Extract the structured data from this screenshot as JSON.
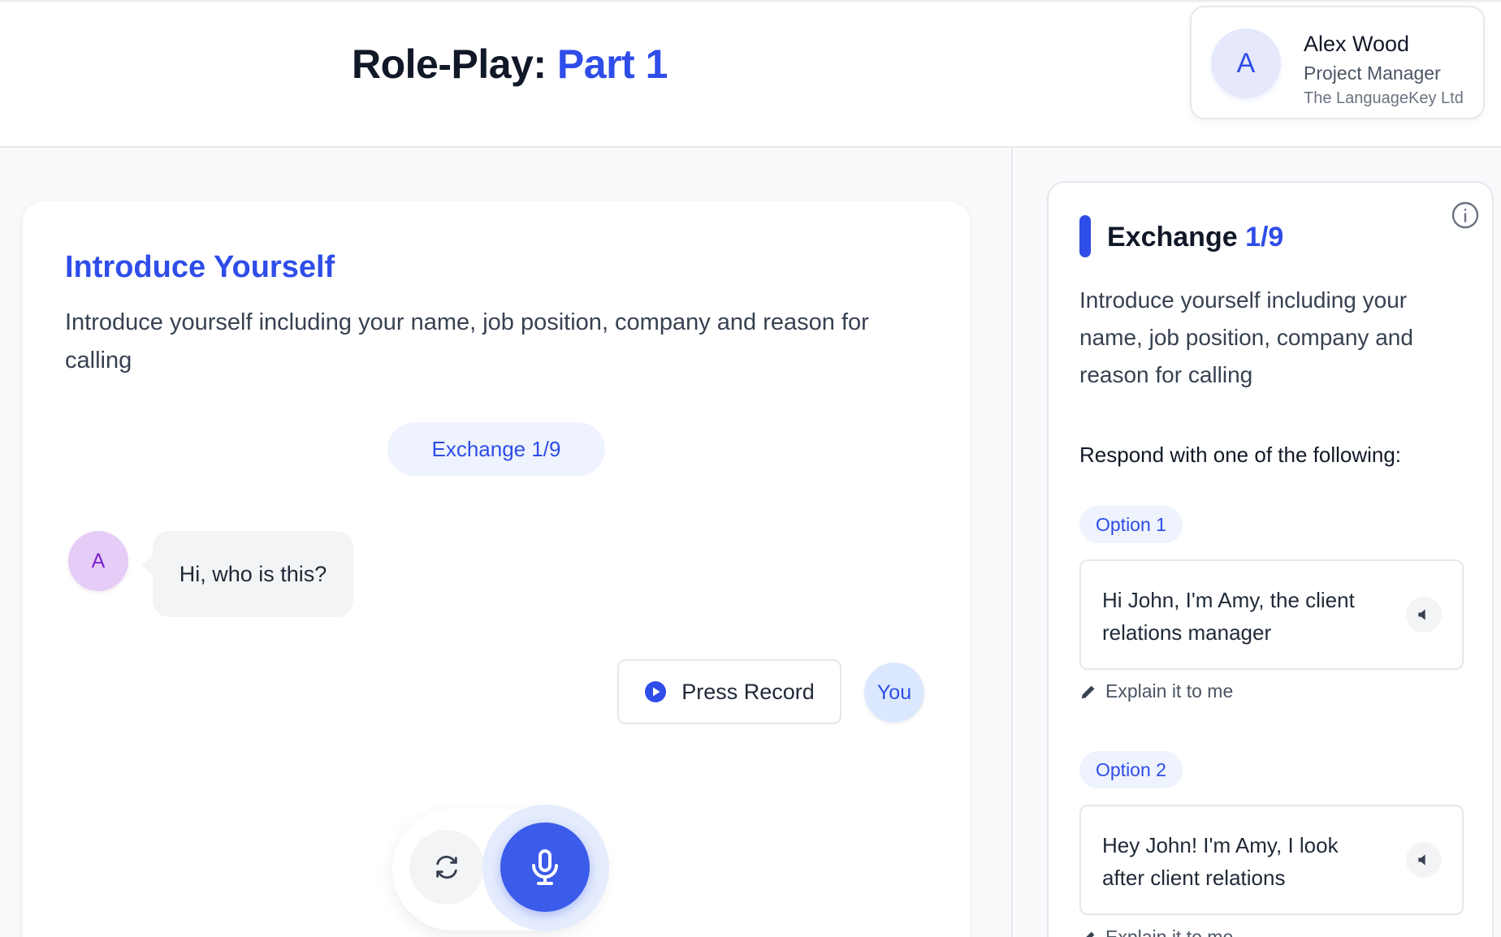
{
  "header": {
    "title_prefix": "Role-Play: ",
    "title_accent": "Part 1",
    "profile": {
      "initial": "A",
      "name": "Alex Wood",
      "role": "Project Manager",
      "company": "The LanguageKey Ltd"
    }
  },
  "main": {
    "task_title": "Introduce Yourself",
    "task_description": "Introduce yourself including your name, job position, company and reason for calling",
    "exchange_pill": "Exchange 1/9",
    "bot": {
      "initial": "A",
      "message": "Hi, who is this?"
    },
    "record_label": "Press Record",
    "you_label": "You",
    "controls": {
      "reset_icon": "refresh-icon",
      "mic_icon": "microphone-icon"
    }
  },
  "panel": {
    "title_prefix": "Exchange ",
    "title_accent": "1/9",
    "description": "Introduce yourself including your name, job position, company and reason for calling",
    "respond_heading": "Respond with one of the following:",
    "options": [
      {
        "tag": "Option 1",
        "text": "Hi John, I'm Amy, the client relations manager",
        "explain": "Explain it to me"
      },
      {
        "tag": "Option 2",
        "text": "Hey John! I'm Amy, I look after client relations",
        "explain": "Explain it to me"
      }
    ]
  },
  "colors": {
    "accent": "#2f4de8",
    "bot_avatar_bg": "#e6cdf7",
    "pill_bg": "#eef3fd"
  }
}
